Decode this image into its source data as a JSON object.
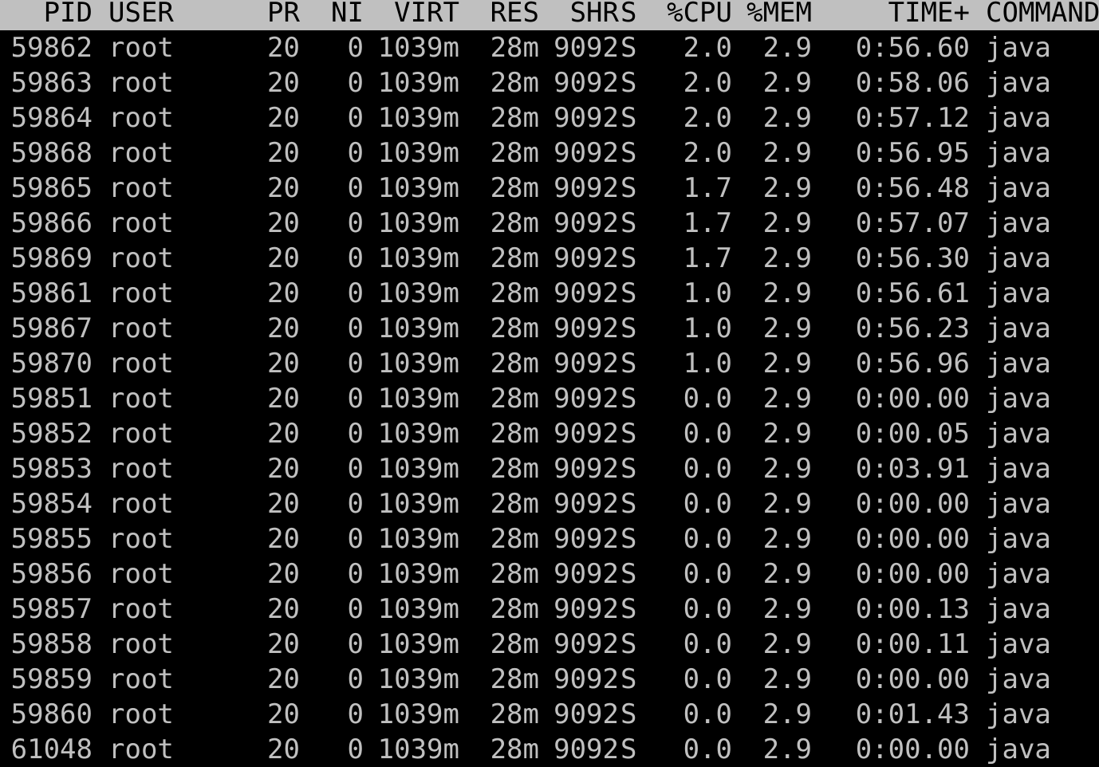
{
  "columns": {
    "pid": "PID",
    "user": "USER",
    "pr": "PR",
    "ni": "NI",
    "virt": "VIRT",
    "res": "RES",
    "shr": "SHR",
    "s": "S",
    "cpu": "%CPU",
    "mem": "%MEM",
    "time": "TIME+",
    "command": "COMMAND"
  },
  "colors": {
    "background": "#000000",
    "text": "#c0c0c0",
    "header_background": "#c0c0c0",
    "header_text": "#000000"
  },
  "rows": [
    {
      "pid": "59862",
      "user": "root",
      "pr": "20",
      "ni": "0",
      "virt": "1039m",
      "res": "28m",
      "shr": "9092",
      "s": "S",
      "cpu": "2.0",
      "mem": "2.9",
      "time": "0:56.60",
      "command": "java"
    },
    {
      "pid": "59863",
      "user": "root",
      "pr": "20",
      "ni": "0",
      "virt": "1039m",
      "res": "28m",
      "shr": "9092",
      "s": "S",
      "cpu": "2.0",
      "mem": "2.9",
      "time": "0:58.06",
      "command": "java"
    },
    {
      "pid": "59864",
      "user": "root",
      "pr": "20",
      "ni": "0",
      "virt": "1039m",
      "res": "28m",
      "shr": "9092",
      "s": "S",
      "cpu": "2.0",
      "mem": "2.9",
      "time": "0:57.12",
      "command": "java"
    },
    {
      "pid": "59868",
      "user": "root",
      "pr": "20",
      "ni": "0",
      "virt": "1039m",
      "res": "28m",
      "shr": "9092",
      "s": "S",
      "cpu": "2.0",
      "mem": "2.9",
      "time": "0:56.95",
      "command": "java"
    },
    {
      "pid": "59865",
      "user": "root",
      "pr": "20",
      "ni": "0",
      "virt": "1039m",
      "res": "28m",
      "shr": "9092",
      "s": "S",
      "cpu": "1.7",
      "mem": "2.9",
      "time": "0:56.48",
      "command": "java"
    },
    {
      "pid": "59866",
      "user": "root",
      "pr": "20",
      "ni": "0",
      "virt": "1039m",
      "res": "28m",
      "shr": "9092",
      "s": "S",
      "cpu": "1.7",
      "mem": "2.9",
      "time": "0:57.07",
      "command": "java"
    },
    {
      "pid": "59869",
      "user": "root",
      "pr": "20",
      "ni": "0",
      "virt": "1039m",
      "res": "28m",
      "shr": "9092",
      "s": "S",
      "cpu": "1.7",
      "mem": "2.9",
      "time": "0:56.30",
      "command": "java"
    },
    {
      "pid": "59861",
      "user": "root",
      "pr": "20",
      "ni": "0",
      "virt": "1039m",
      "res": "28m",
      "shr": "9092",
      "s": "S",
      "cpu": "1.0",
      "mem": "2.9",
      "time": "0:56.61",
      "command": "java"
    },
    {
      "pid": "59867",
      "user": "root",
      "pr": "20",
      "ni": "0",
      "virt": "1039m",
      "res": "28m",
      "shr": "9092",
      "s": "S",
      "cpu": "1.0",
      "mem": "2.9",
      "time": "0:56.23",
      "command": "java"
    },
    {
      "pid": "59870",
      "user": "root",
      "pr": "20",
      "ni": "0",
      "virt": "1039m",
      "res": "28m",
      "shr": "9092",
      "s": "S",
      "cpu": "1.0",
      "mem": "2.9",
      "time": "0:56.96",
      "command": "java"
    },
    {
      "pid": "59851",
      "user": "root",
      "pr": "20",
      "ni": "0",
      "virt": "1039m",
      "res": "28m",
      "shr": "9092",
      "s": "S",
      "cpu": "0.0",
      "mem": "2.9",
      "time": "0:00.00",
      "command": "java"
    },
    {
      "pid": "59852",
      "user": "root",
      "pr": "20",
      "ni": "0",
      "virt": "1039m",
      "res": "28m",
      "shr": "9092",
      "s": "S",
      "cpu": "0.0",
      "mem": "2.9",
      "time": "0:00.05",
      "command": "java"
    },
    {
      "pid": "59853",
      "user": "root",
      "pr": "20",
      "ni": "0",
      "virt": "1039m",
      "res": "28m",
      "shr": "9092",
      "s": "S",
      "cpu": "0.0",
      "mem": "2.9",
      "time": "0:03.91",
      "command": "java"
    },
    {
      "pid": "59854",
      "user": "root",
      "pr": "20",
      "ni": "0",
      "virt": "1039m",
      "res": "28m",
      "shr": "9092",
      "s": "S",
      "cpu": "0.0",
      "mem": "2.9",
      "time": "0:00.00",
      "command": "java"
    },
    {
      "pid": "59855",
      "user": "root",
      "pr": "20",
      "ni": "0",
      "virt": "1039m",
      "res": "28m",
      "shr": "9092",
      "s": "S",
      "cpu": "0.0",
      "mem": "2.9",
      "time": "0:00.00",
      "command": "java"
    },
    {
      "pid": "59856",
      "user": "root",
      "pr": "20",
      "ni": "0",
      "virt": "1039m",
      "res": "28m",
      "shr": "9092",
      "s": "S",
      "cpu": "0.0",
      "mem": "2.9",
      "time": "0:00.00",
      "command": "java"
    },
    {
      "pid": "59857",
      "user": "root",
      "pr": "20",
      "ni": "0",
      "virt": "1039m",
      "res": "28m",
      "shr": "9092",
      "s": "S",
      "cpu": "0.0",
      "mem": "2.9",
      "time": "0:00.13",
      "command": "java"
    },
    {
      "pid": "59858",
      "user": "root",
      "pr": "20",
      "ni": "0",
      "virt": "1039m",
      "res": "28m",
      "shr": "9092",
      "s": "S",
      "cpu": "0.0",
      "mem": "2.9",
      "time": "0:00.11",
      "command": "java"
    },
    {
      "pid": "59859",
      "user": "root",
      "pr": "20",
      "ni": "0",
      "virt": "1039m",
      "res": "28m",
      "shr": "9092",
      "s": "S",
      "cpu": "0.0",
      "mem": "2.9",
      "time": "0:00.00",
      "command": "java"
    },
    {
      "pid": "59860",
      "user": "root",
      "pr": "20",
      "ni": "0",
      "virt": "1039m",
      "res": "28m",
      "shr": "9092",
      "s": "S",
      "cpu": "0.0",
      "mem": "2.9",
      "time": "0:01.43",
      "command": "java"
    },
    {
      "pid": "61048",
      "user": "root",
      "pr": "20",
      "ni": "0",
      "virt": "1039m",
      "res": "28m",
      "shr": "9092",
      "s": "S",
      "cpu": "0.0",
      "mem": "2.9",
      "time": "0:00.00",
      "command": "java"
    }
  ]
}
